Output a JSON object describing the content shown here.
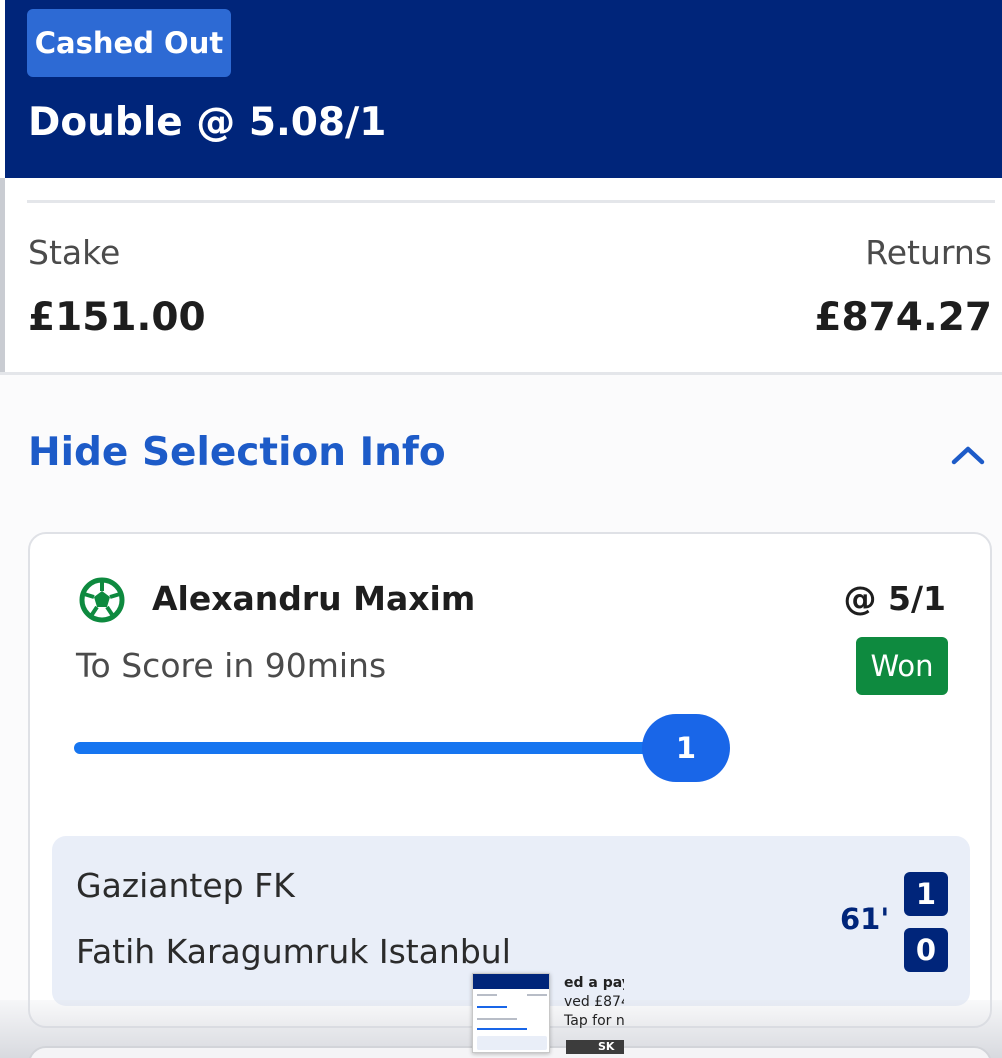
{
  "header": {
    "status_badge": "Cashed Out",
    "bet_title": "Double @ 5.08/1",
    "background_color": "#00257a",
    "badge_color": "#2d6ad4"
  },
  "summary": {
    "stake_label": "Stake",
    "stake_value": "£151.00",
    "returns_label": "Returns",
    "returns_value": "£874.27"
  },
  "selection_toggle": {
    "label": "Hide Selection Info",
    "icon": "chevron-up-icon",
    "accent_color": "#1d5bc8"
  },
  "selection": {
    "icon": "football-icon",
    "name": "Alexandru Maxim",
    "odds": "@ 5/1",
    "market": "To Score in 90mins",
    "result": "Won",
    "result_color": "#0e8a3f",
    "progress": {
      "value": "1",
      "fraction": 1.0,
      "color": "#1675f0"
    }
  },
  "match": {
    "home_team": "Gaziantep FK",
    "away_team": "Fatih Karagumruk Istanbul",
    "clock": "61'",
    "home_score": "1",
    "away_score": "0"
  },
  "overlay": {
    "notification_lines": [
      "ed a pay",
      "ved £874",
      "Tap for n"
    ],
    "brand_fragment": "SK"
  }
}
